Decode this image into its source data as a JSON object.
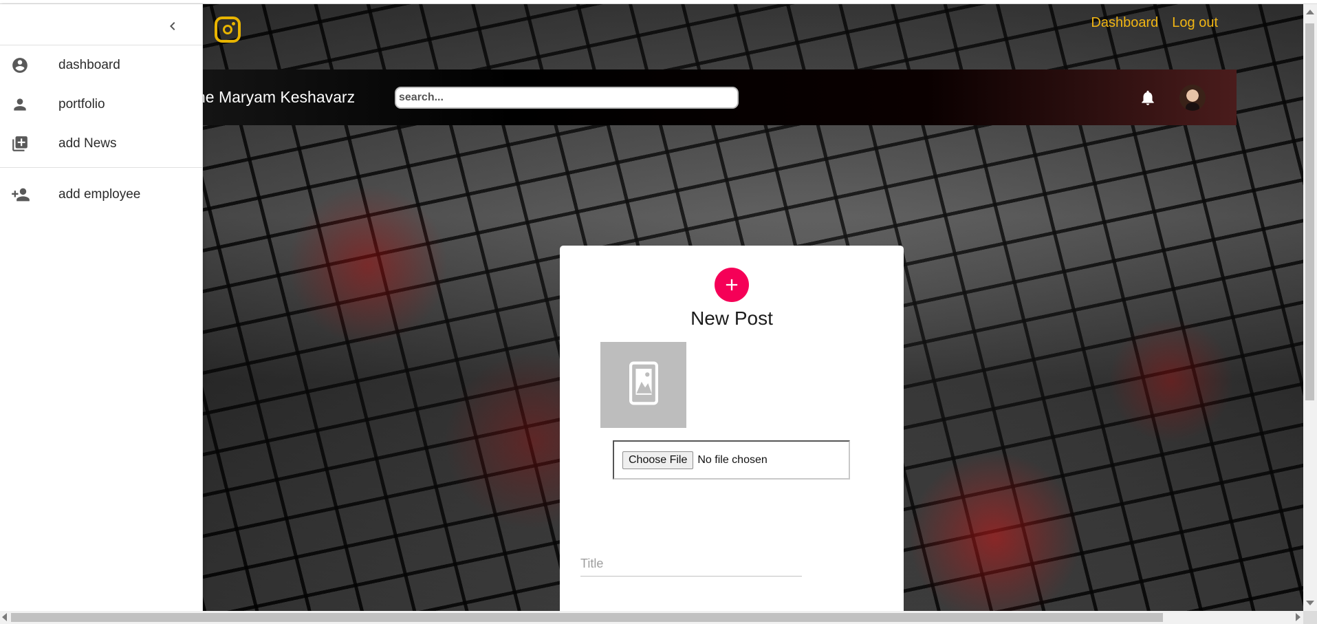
{
  "header": {
    "brand_icon": "instagram-icon",
    "nav_links": [
      "Dashboard",
      "Log out"
    ],
    "welcome_text": "ne Maryam Keshavarz",
    "search_placeholder": "search...",
    "notification_icon": "bell-icon",
    "link_color": "#f2b614"
  },
  "drawer": {
    "collapse_icon": "chevron-left-icon",
    "items": [
      {
        "label": "dashboard",
        "icon": "account-circle-icon"
      },
      {
        "label": "portfolio",
        "icon": "person-icon"
      },
      {
        "label": "add News",
        "icon": "library-add-icon"
      },
      {
        "label": "add employee",
        "icon": "person-add-icon"
      }
    ]
  },
  "form": {
    "title": "New Post",
    "fab_icon": "plus-icon",
    "fab_color": "#f50057",
    "image_placeholder_icon": "image-placeholder-icon",
    "choose_file_label": "Choose File",
    "no_file_text": "No file chosen",
    "title_placeholder": "Title"
  }
}
